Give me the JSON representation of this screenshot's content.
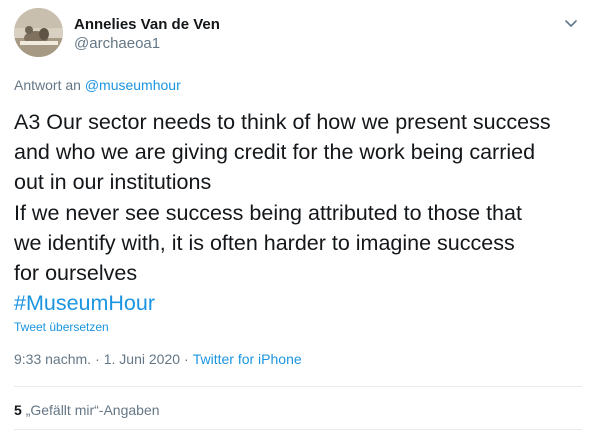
{
  "author": {
    "name": "Annelies Van de Ven",
    "handle": "@archaeoa1"
  },
  "reply": {
    "prefix": "Antwort an ",
    "to": "@museumhour"
  },
  "tweet": {
    "lines": [
      "A3 Our sector needs to think of how we present success",
      "and who we are giving credit for the work being carried",
      "out in our institutions",
      "If we never see success being attributed to those that",
      "we identify with, it is often harder to imagine success",
      "for ourselves"
    ],
    "hashtag": "#MuseumHour",
    "translate_label": "Tweet übersetzen"
  },
  "meta": {
    "time": "9:33 nachm.",
    "separator": "·",
    "date": "1. Juni 2020",
    "source": "Twitter for iPhone"
  },
  "stats": {
    "likes_count": "5",
    "likes_label": "„Gefällt mir“-Angaben"
  },
  "icons": {
    "more": "chevron-down-icon",
    "avatar": "avatar-photo"
  },
  "colors": {
    "link": "#1b95e0",
    "secondary_text": "#657786",
    "primary_text": "#14171a",
    "divider": "#e6ecf0"
  }
}
